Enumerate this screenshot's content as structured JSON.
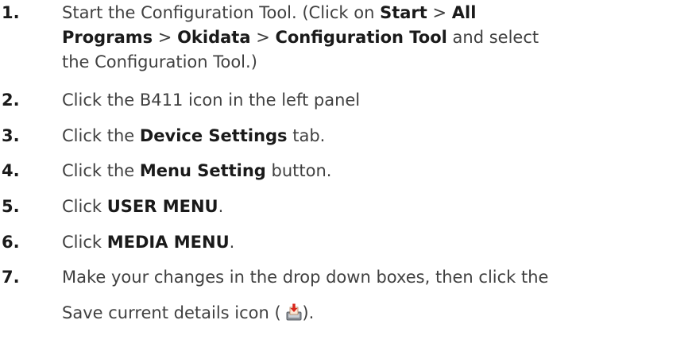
{
  "steps": [
    {
      "number": "1.",
      "line1_a": "Start the Configuration Tool. (Click on ",
      "line1_b": "Start",
      "line1_c": " > ",
      "line1_d": "All",
      "line2_a": "Programs",
      "line2_b": " > ",
      "line2_c": "Okidata",
      "line2_d": " > ",
      "line2_e": "Configuration Tool",
      "line2_f": " and select",
      "line3": "the Configuration Tool.)"
    },
    {
      "number": "2.",
      "text": "Click the B411 icon in the left panel"
    },
    {
      "number": "3.",
      "pre": "Click the ",
      "bold": "Device Settings",
      "post": " tab."
    },
    {
      "number": "4.",
      "pre": "Click the ",
      "bold": "Menu Setting",
      "post": " button."
    },
    {
      "number": "5.",
      "pre": "Click ",
      "bold": "USER MENU",
      "post": "."
    },
    {
      "number": "6.",
      "pre": "Click ",
      "bold": "MEDIA MENU",
      "post": "."
    },
    {
      "number": "7.",
      "line1": "Make your changes in the drop down boxes, then click the",
      "line2_pre": "Save current details icon ( ",
      "line2_post": ")."
    }
  ],
  "icons": {
    "save": "save-current-details-icon"
  }
}
